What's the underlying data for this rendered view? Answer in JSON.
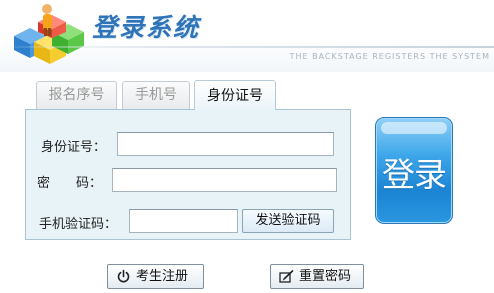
{
  "header": {
    "title": "登录系统",
    "subtitle": "THE BACKSTAGE REGISTERS THE SYSTEM",
    "logo_icon": "people-cubes-logo"
  },
  "tabs": [
    {
      "label": "报名序号",
      "active": false
    },
    {
      "label": "手机号",
      "active": false
    },
    {
      "label": "身份证号",
      "active": true
    }
  ],
  "form": {
    "id_label": "身份证号：",
    "id_value": "",
    "password_label": "密　　码：",
    "password_value": "",
    "sms_label": "手机验证码：",
    "sms_value": "",
    "send_code_label": "发送验证码"
  },
  "login_button": {
    "label": "登录"
  },
  "bottom_buttons": {
    "register_label": "考生注册",
    "register_icon": "power-icon",
    "reset_label": "重置密码",
    "reset_icon": "edit-icon"
  },
  "colors": {
    "accent": "#1b84d4",
    "panel_bg": "#e8f3f8",
    "title": "#2f74b8"
  }
}
